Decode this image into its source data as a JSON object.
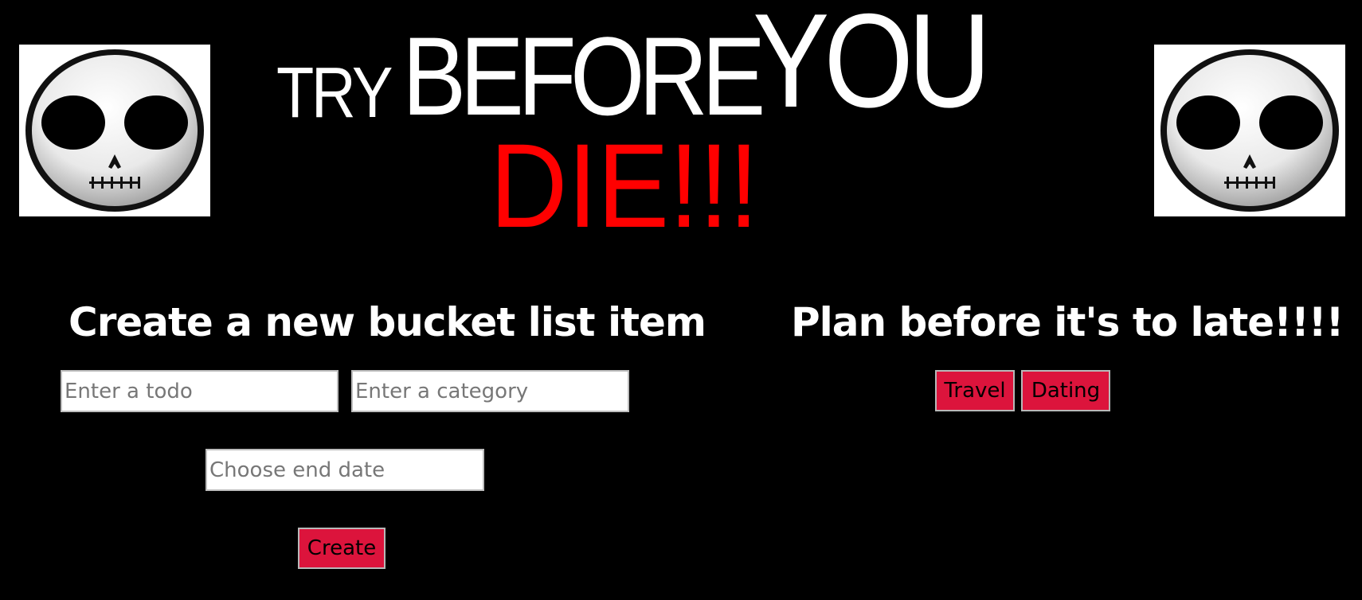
{
  "header": {
    "title_try": "TRY",
    "title_before": "BEFORE",
    "title_you": "YOU",
    "title_die": "DIE!!!",
    "left_image_icon": "skull-emoji-icon",
    "right_image_icon": "skull-emoji-icon"
  },
  "create_panel": {
    "heading": "Create a new bucket list item",
    "todo_placeholder": "Enter a todo",
    "todo_value": "",
    "category_placeholder": "Enter a category",
    "category_value": "",
    "date_placeholder": "Choose end date",
    "date_value": "",
    "create_label": "Create"
  },
  "plan_panel": {
    "heading": "Plan before it's to late!!!!",
    "categories": [
      "Travel",
      "Dating"
    ]
  },
  "colors": {
    "background": "#000000",
    "title_white": "#ffffff",
    "title_red": "#ff0000",
    "button_crimson": "#dc143c"
  }
}
